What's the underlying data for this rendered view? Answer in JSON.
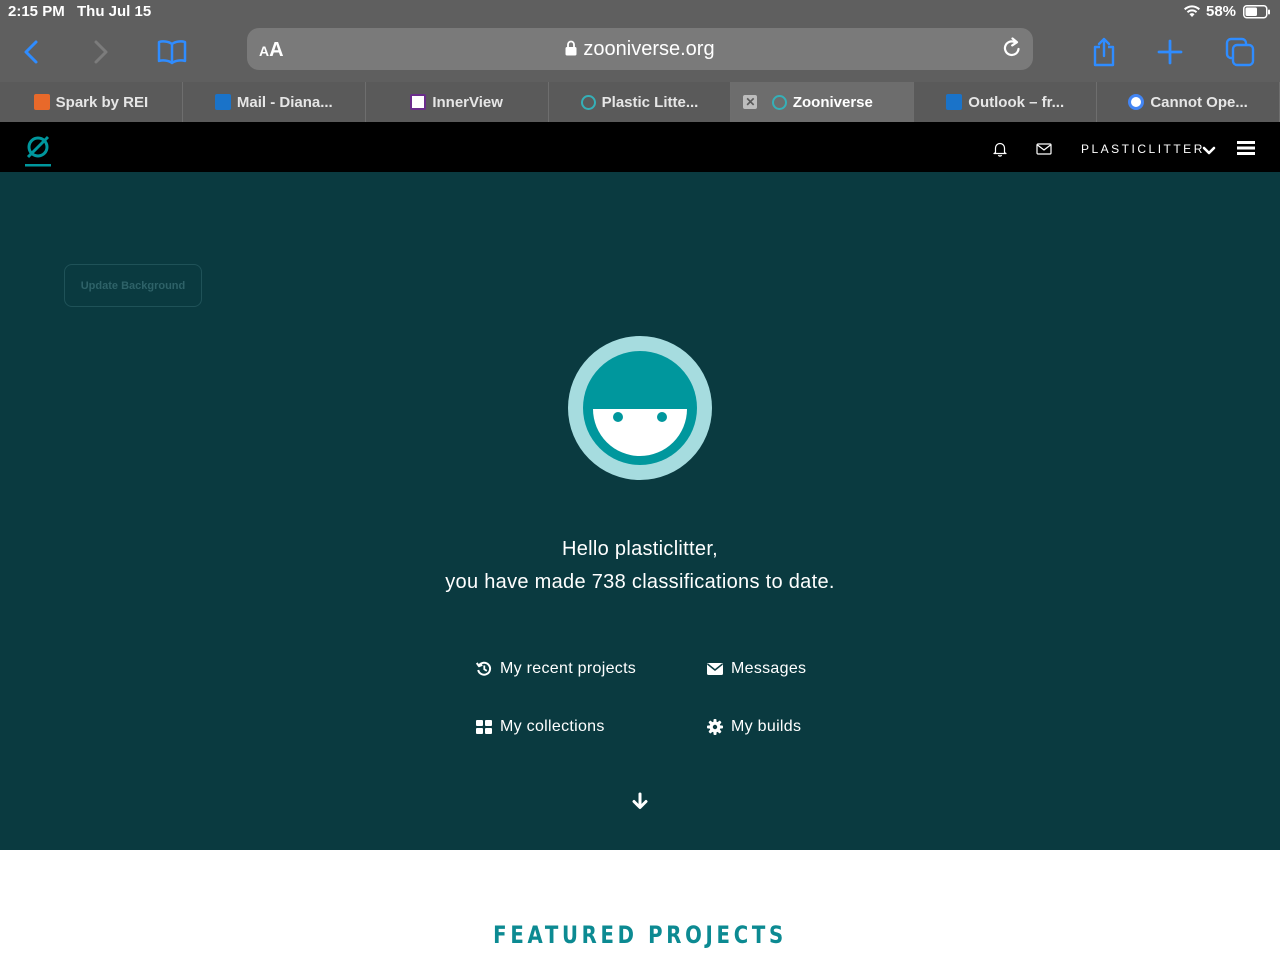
{
  "status_bar": {
    "time": "2:15 PM",
    "date": "Thu Jul 15",
    "battery": "58%"
  },
  "browser": {
    "text_size_label": "AA",
    "url": "zooniverse.org",
    "tabs": [
      {
        "title": "Spark by REI",
        "favicon": "rei-icon",
        "color": "#e8692a"
      },
      {
        "title": "Mail - Diana...",
        "favicon": "outlook-icon",
        "color": "#1a73c9"
      },
      {
        "title": "InnerView",
        "favicon": "innerview-icon",
        "color": "#6b2d8c"
      },
      {
        "title": "Plastic Litte...",
        "favicon": "zooniverse-icon",
        "color": "#35b0b8"
      },
      {
        "title": "Zooniverse",
        "favicon": "zooniverse-icon",
        "color": "#35b0b8",
        "active": true
      },
      {
        "title": "Outlook – fr...",
        "favicon": "outlook-icon",
        "color": "#1a73c9"
      },
      {
        "title": "Cannot Ope...",
        "favicon": "google-icon",
        "color": "#4285f4"
      }
    ]
  },
  "site_nav": {
    "username": "PLASTICLITTER"
  },
  "hero": {
    "update_background_label": "Update Background",
    "greeting_line1": "Hello plasticlitter,",
    "greeting_line2": "you have made 738 classifications to date.",
    "links": {
      "recent_projects": "My recent projects",
      "messages": "Messages",
      "collections": "My collections",
      "builds": "My builds"
    }
  },
  "featured": {
    "heading": "FEATURED PROJECTS"
  },
  "colors": {
    "hero_bg": "#0a3a40",
    "accent": "#00979d",
    "avatar_ring": "#a6dcdf",
    "nav_bg": "#000000"
  }
}
